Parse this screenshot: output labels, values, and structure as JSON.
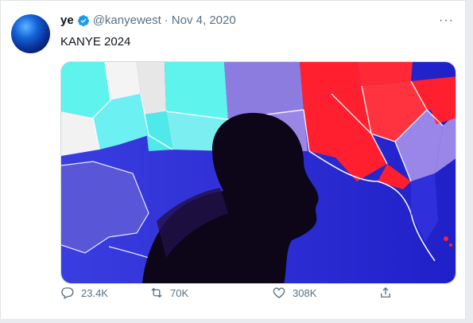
{
  "tweet": {
    "author_name": "ye",
    "handle": "@kanyewest",
    "separator": "·",
    "date": "Nov 4, 2020",
    "more_label": "···",
    "text": "KANYE 2024",
    "media_icon": "photo-election-map",
    "verified_icon": "verified-badge-icon"
  },
  "actions": {
    "reply_count": "23.4K",
    "retweet_count": "70K",
    "like_count": "308K"
  },
  "colors": {
    "verified": "#1d9bf0",
    "text_secondary": "#5b7083",
    "map_red": "#ff1f2f",
    "map_cyan": "#5ff3ee",
    "map_blue": "#2a2bd6"
  }
}
